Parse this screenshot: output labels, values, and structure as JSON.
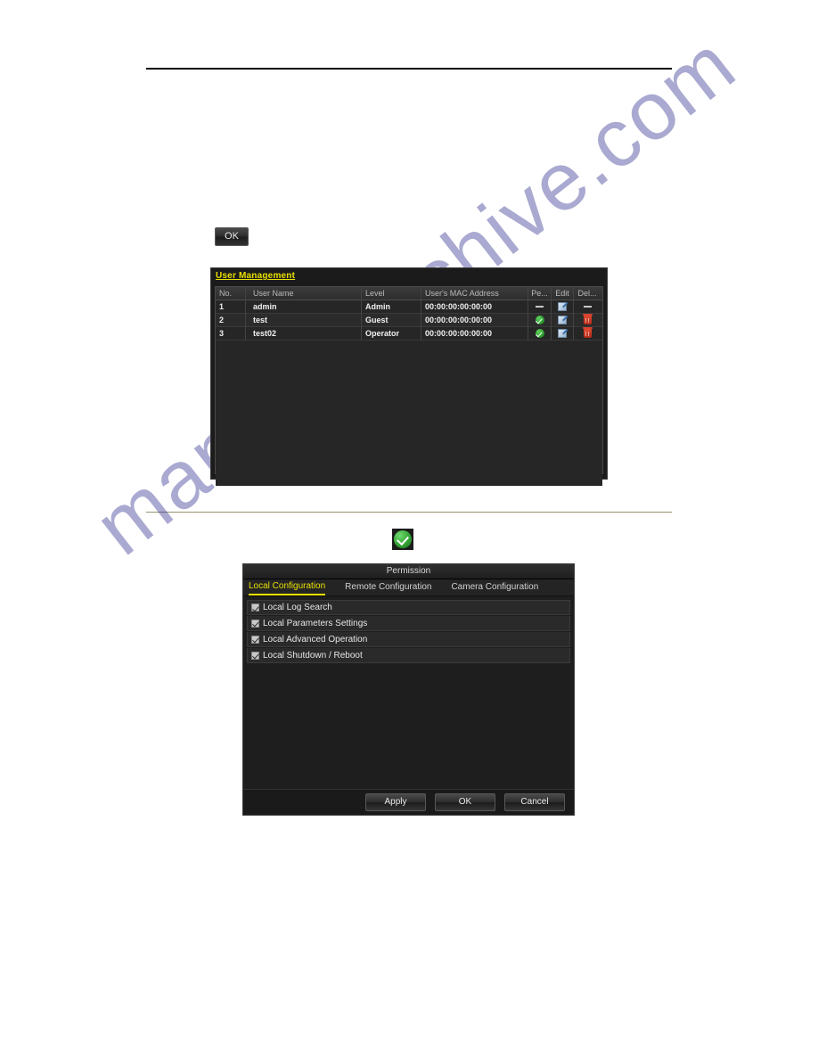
{
  "document": {
    "watermark_text": "manualsarchive.com"
  },
  "ok_button": {
    "label": "OK"
  },
  "user_management": {
    "title": "User Management",
    "columns": [
      "No.",
      "User Name",
      "Level",
      "User's MAC Address",
      "Pe...",
      "Edit",
      "Del..."
    ],
    "rows": [
      {
        "no": "1",
        "user_name": "admin",
        "level": "Admin",
        "mac": "00:00:00:00:00:00",
        "permission_icon": "dash-icon",
        "edit_icon": "edit-icon",
        "delete_icon": "dash-icon"
      },
      {
        "no": "2",
        "user_name": "test",
        "level": "Guest",
        "mac": "00:00:00:00:00:00",
        "permission_icon": "green-check-icon",
        "edit_icon": "edit-icon",
        "delete_icon": "trash-icon"
      },
      {
        "no": "3",
        "user_name": "test02",
        "level": "Operator",
        "mac": "00:00:00:00:00:00",
        "permission_icon": "green-check-icon",
        "edit_icon": "edit-icon",
        "delete_icon": "trash-icon"
      }
    ]
  },
  "inline_icon": {
    "name": "green-check-icon"
  },
  "permission_dialog": {
    "title": "Permission",
    "tabs": [
      {
        "label": "Local Configuration",
        "active": true
      },
      {
        "label": "Remote Configuration",
        "active": false
      },
      {
        "label": "Camera Configuration",
        "active": false
      }
    ],
    "items": [
      {
        "label": "Local Log Search",
        "checked": true
      },
      {
        "label": "Local Parameters Settings",
        "checked": true
      },
      {
        "label": "Local Advanced Operation",
        "checked": true
      },
      {
        "label": "Local Shutdown / Reboot",
        "checked": true
      }
    ],
    "buttons": {
      "apply": "Apply",
      "ok": "OK",
      "cancel": "Cancel"
    }
  },
  "colors": {
    "accent_yellow": "#e8e000",
    "status_green": "#2e9e2e",
    "delete_red": "#b32a18",
    "panel_bg": "#1b1b1b",
    "divider_tan": "#9a9470"
  }
}
